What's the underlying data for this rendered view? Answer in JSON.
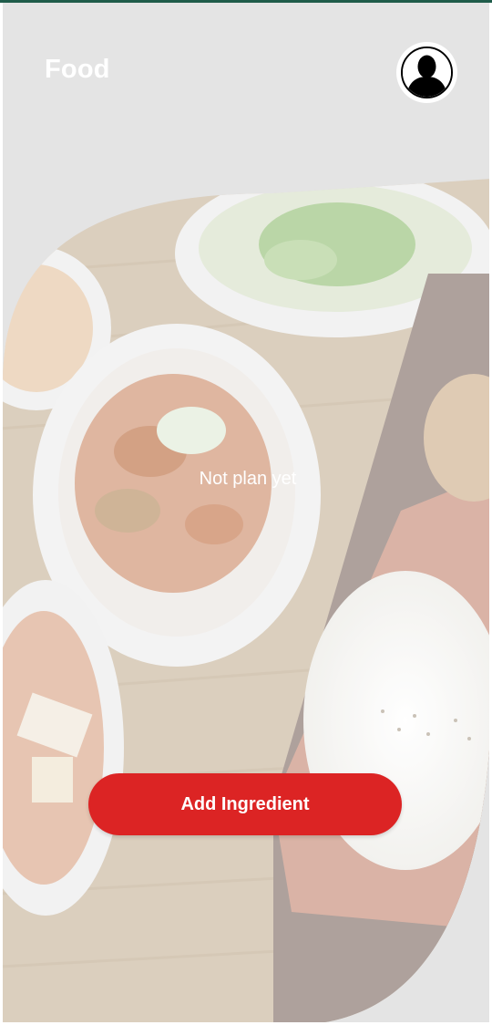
{
  "header": {
    "title": "Food",
    "avatar_icon": "person-icon"
  },
  "main": {
    "empty_message": "Not plan yet",
    "add_button_label": "Add Ingredient"
  },
  "colors": {
    "status_line": "#1f5c4a",
    "background": "#e4e4e4",
    "accent": "#dc2424"
  }
}
